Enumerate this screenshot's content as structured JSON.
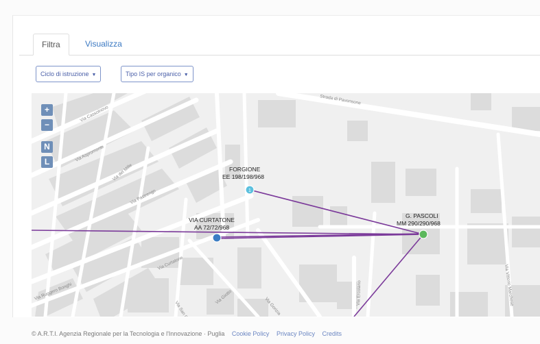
{
  "tabs": [
    {
      "label": "Filtra",
      "active": true
    },
    {
      "label": "Visualizza",
      "active": false
    }
  ],
  "filters": [
    {
      "label": "Ciclo di istruzione"
    },
    {
      "label": "Tipo IS per organico"
    }
  ],
  "map": {
    "zoom_controls": [
      "+",
      "−",
      "N",
      "L"
    ],
    "streets": [
      "Via Cassolnovo",
      "Via Aspromonte",
      "Via del Mille",
      "Via Pastrengo",
      "Strada di Pavonsone",
      "Via Curtatone",
      "Via Ruggero Bonghi",
      "Via Ercolano",
      "Via Giotto",
      "Via Gorizia",
      "Via Vittorio Marchese",
      "Via San Cristoforo"
    ],
    "markers": [
      {
        "name": "FORGIONE",
        "code": "EE 198/198/968",
        "color": "#5bc0de",
        "badge": "1"
      },
      {
        "name": "VIA CURTATONE",
        "code": "AA 72/72/968",
        "color": "#3b7dc4"
      },
      {
        "name": "G. PASCOLI",
        "code": "MM 290/290/968",
        "color": "#5cb85c"
      }
    ],
    "link_color": "#7b3a9a"
  },
  "footer": {
    "attribution": "© A.R.T.I. Agenzia Regionale per la Tecnologia e l'Innovazione · Puglia",
    "links": [
      "Cookie Policy",
      "Privacy Policy",
      "Credits"
    ]
  }
}
